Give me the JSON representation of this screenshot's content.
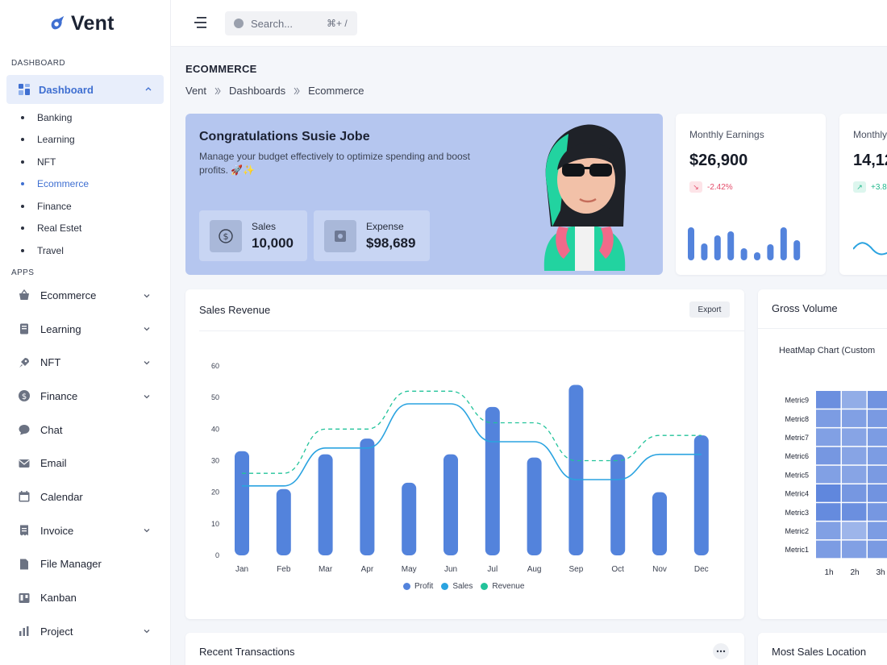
{
  "brand": {
    "name": "Vent"
  },
  "sidebar": {
    "section_dashboard": "DASHBOARD",
    "dashboard_label": "Dashboard",
    "sub_items": [
      {
        "label": "Banking",
        "active": false
      },
      {
        "label": "Learning",
        "active": false
      },
      {
        "label": "NFT",
        "active": false
      },
      {
        "label": "Ecommerce",
        "active": true
      },
      {
        "label": "Finance",
        "active": false
      },
      {
        "label": "Real Estet",
        "active": false
      },
      {
        "label": "Travel",
        "active": false
      }
    ],
    "section_apps": "APPS",
    "apps": [
      {
        "label": "Ecommerce",
        "icon": "basket-icon",
        "expandable": true
      },
      {
        "label": "Learning",
        "icon": "book-icon",
        "expandable": true
      },
      {
        "label": "NFT",
        "icon": "rocket-icon",
        "expandable": true
      },
      {
        "label": "Finance",
        "icon": "dollar-icon",
        "expandable": true
      },
      {
        "label": "Chat",
        "icon": "chat-icon",
        "expandable": false
      },
      {
        "label": "Email",
        "icon": "email-icon",
        "expandable": false
      },
      {
        "label": "Calendar",
        "icon": "calendar-icon",
        "expandable": false
      },
      {
        "label": "Invoice",
        "icon": "invoice-icon",
        "expandable": true
      },
      {
        "label": "File Manager",
        "icon": "file-icon",
        "expandable": false
      },
      {
        "label": "Kanban",
        "icon": "kanban-icon",
        "expandable": false
      },
      {
        "label": "Project",
        "icon": "bar-chart-icon",
        "expandable": true
      }
    ]
  },
  "header": {
    "search_placeholder": "Search...",
    "search_shortcut": "⌘+ /"
  },
  "page": {
    "title": "ECOMMERCE",
    "breadcrumb": [
      "Vent",
      "Dashboards",
      "Ecommerce"
    ]
  },
  "welcome": {
    "title": "Congratulations Susie Jobe",
    "message": "Manage your budget effectively to optimize spending and boost profits. 🚀✨",
    "sales_label": "Sales",
    "sales_value": "10,000",
    "expense_label": "Expense",
    "expense_value": "$98,689"
  },
  "monthly_earnings": {
    "title": "Monthly Earnings",
    "value": "$26,900",
    "change": "-2.42%",
    "bars": [
      0.82,
      0.42,
      0.62,
      0.72,
      0.3,
      0.2,
      0.4,
      0.82,
      0.5
    ]
  },
  "second_stat": {
    "title": "Monthly",
    "value": "14,12",
    "change": "+3.8"
  },
  "sales_revenue": {
    "title": "Sales Revenue",
    "export_label": "Export"
  },
  "gross_volume": {
    "title": "Gross Volume",
    "heatmap_title": "HeatMap Chart (Custom",
    "metrics": [
      "Metric9",
      "Metric8",
      "Metric7",
      "Metric6",
      "Metric5",
      "Metric4",
      "Metric3",
      "Metric2",
      "Metric1"
    ],
    "hours": [
      "1h",
      "2h",
      "3h"
    ],
    "intensity": [
      [
        0.75,
        0.4,
        0.7
      ],
      [
        0.6,
        0.55,
        0.62
      ],
      [
        0.55,
        0.5,
        0.6
      ],
      [
        0.65,
        0.5,
        0.6
      ],
      [
        0.55,
        0.5,
        0.62
      ],
      [
        0.85,
        0.65,
        0.7
      ],
      [
        0.8,
        0.75,
        0.65
      ],
      [
        0.55,
        0.3,
        0.6
      ],
      [
        0.6,
        0.55,
        0.62
      ]
    ]
  },
  "recent_transactions": {
    "title": "Recent Transactions"
  },
  "most_sales_location": {
    "title": "Most Sales Location"
  },
  "colors": {
    "accent": "#3f6fd1",
    "bar": "#5383dc",
    "sales_line": "#2aa3e0",
    "revenue_line": "#22c39a",
    "welcome_bg": "#b5c6ef"
  },
  "chart_data": {
    "type": "bar",
    "categories": [
      "Jan",
      "Feb",
      "Mar",
      "Apr",
      "May",
      "Jun",
      "Jul",
      "Aug",
      "Sep",
      "Oct",
      "Nov",
      "Dec"
    ],
    "ylim": [
      0,
      60
    ],
    "yticks": [
      0,
      10,
      20,
      30,
      40,
      50,
      60
    ],
    "series": [
      {
        "name": "Profit",
        "type": "bar",
        "values": [
          33,
          21,
          32,
          37,
          23,
          32,
          47,
          31,
          54,
          32,
          20,
          38
        ]
      },
      {
        "name": "Sales",
        "type": "line",
        "values": [
          22,
          22,
          34,
          34,
          48,
          48,
          36,
          36,
          24,
          24,
          32,
          32
        ]
      },
      {
        "name": "Revenue",
        "type": "line-dashed",
        "values": [
          26,
          26,
          40,
          40,
          52,
          52,
          42,
          42,
          30,
          30,
          38,
          38
        ]
      }
    ],
    "grid": false,
    "legend": "bottom-center"
  }
}
